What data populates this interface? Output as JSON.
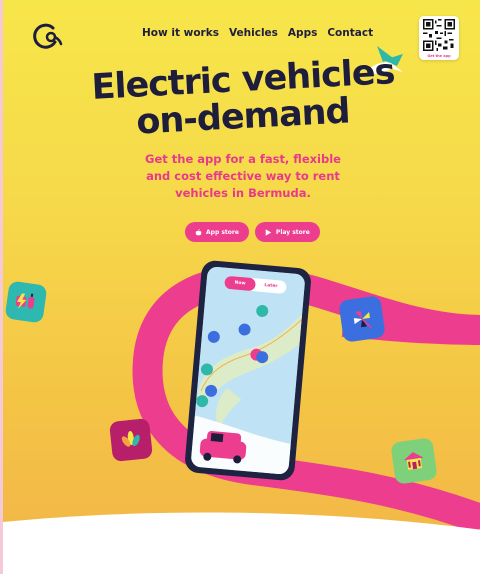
{
  "nav": {
    "items": [
      "How it works",
      "Vehicles",
      "Apps",
      "Contact"
    ]
  },
  "qr": {
    "label": "Get the app"
  },
  "hero": {
    "title_line1": "Electric vehicles",
    "title_line2": "on-demand",
    "subtitle": "Get the app for a fast, flexible and cost effective way to rent vehicles in Bermuda."
  },
  "buttons": {
    "app_store": "App store",
    "play_store": "Play store"
  },
  "phone": {
    "toggle_now": "Now",
    "toggle_later": "Later"
  },
  "colors": {
    "brand_pink": "#ec3d8e",
    "navy": "#1e1e3c",
    "yellow": "#f7e64a",
    "blue_icon": "#3b6fe0",
    "green_icon": "#7fd07a",
    "teal": "#2fb8a8"
  },
  "icons": [
    "logo-icon",
    "apple-icon",
    "play-icon",
    "lightning-icon",
    "pinwheel-icon",
    "flower-icon",
    "house-icon",
    "bird-icon"
  ]
}
